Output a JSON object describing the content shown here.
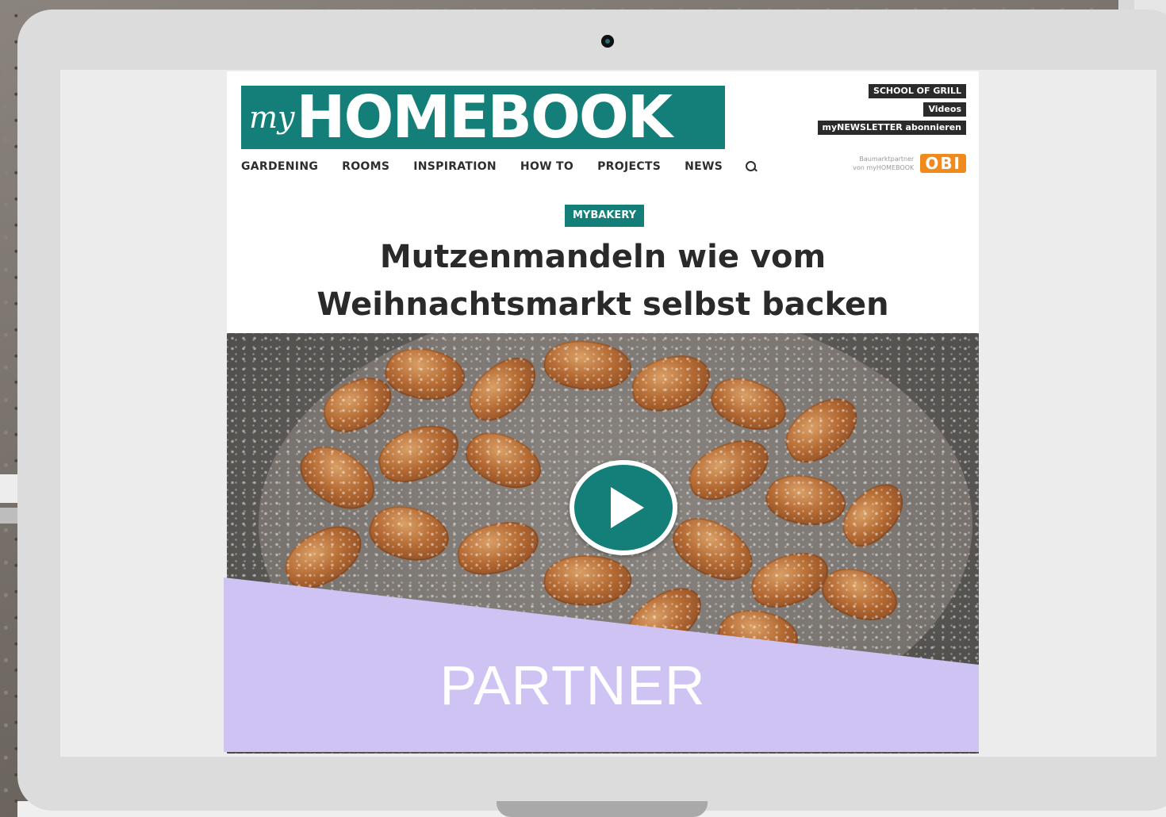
{
  "site": {
    "logo_prefix": "my",
    "logo_main": "HOMEBOOK",
    "top_links": [
      "SCHOOL OF GRILL",
      "Videos",
      "myNEWSLETTER abonnieren"
    ],
    "nav": [
      "GARDENING",
      "ROOMS",
      "INSPIRATION",
      "HOW TO",
      "PROJECTS",
      "NEWS"
    ],
    "partner_text_line1": "Baumarktpartner",
    "partner_text_line2": "von myHOMEBOOK",
    "partner_logo": "OBI"
  },
  "article": {
    "category": "MYBAKERY",
    "headline_line1": "Mutzenmandeln wie vom",
    "headline_line2": "Weihnachtsmarkt selbst backen"
  },
  "overlay": {
    "banner_label": "PARTNER"
  },
  "colors": {
    "brand_teal": "#137f78",
    "banner_lavender": "#cec3f3",
    "obi_orange": "#f08a1c"
  },
  "icons": {
    "search": "search-icon",
    "play": "play-icon"
  }
}
